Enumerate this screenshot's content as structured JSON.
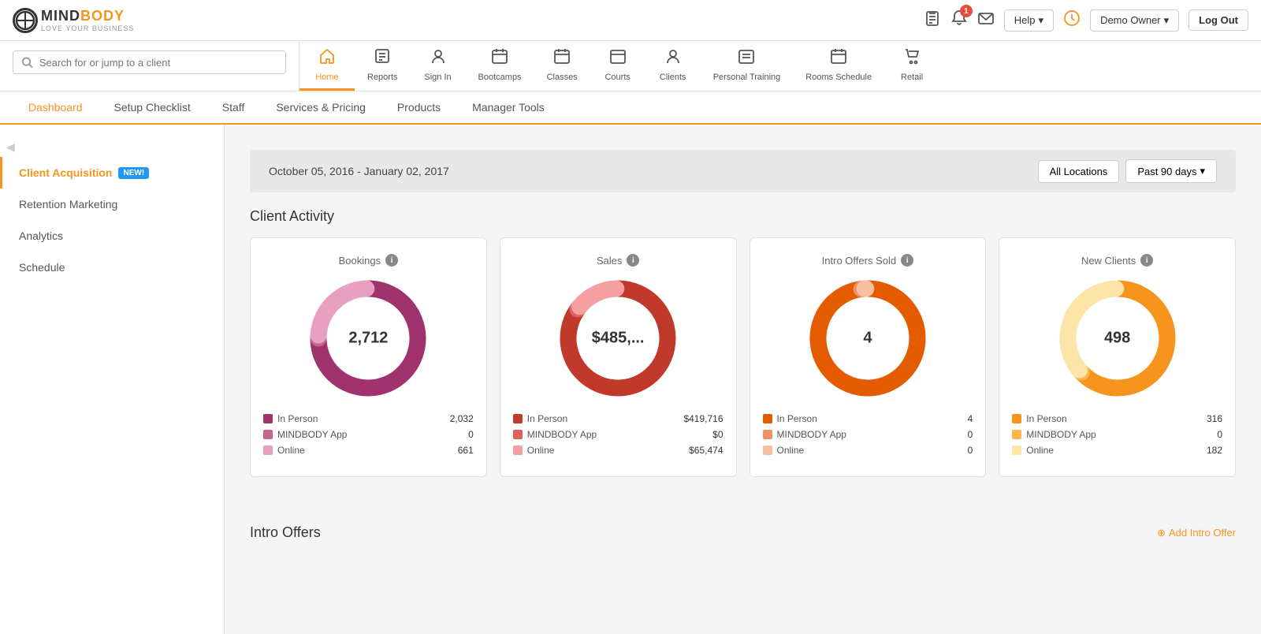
{
  "app": {
    "name": "MINDBODY",
    "tagline": "LOVE YOUR BUSINESS"
  },
  "top_bar": {
    "help_label": "Help",
    "user_label": "Demo Owner",
    "logout_label": "Log Out",
    "notification_count": "1"
  },
  "search": {
    "placeholder": "Search for or jump to a client"
  },
  "nav_tabs": [
    {
      "id": "home",
      "label": "Home",
      "icon": "🏠",
      "active": true
    },
    {
      "id": "reports",
      "label": "Reports",
      "icon": "📊",
      "active": false
    },
    {
      "id": "sign-in",
      "label": "Sign In",
      "icon": "👤",
      "active": false
    },
    {
      "id": "bootcamps",
      "label": "Bootcamps",
      "icon": "📅",
      "active": false
    },
    {
      "id": "classes",
      "label": "Classes",
      "icon": "📋",
      "active": false
    },
    {
      "id": "courts",
      "label": "Courts",
      "icon": "📅",
      "active": false
    },
    {
      "id": "clients",
      "label": "Clients",
      "icon": "👤",
      "active": false
    },
    {
      "id": "personal-training",
      "label": "Personal Training",
      "icon": "📋",
      "active": false
    },
    {
      "id": "rooms-schedule",
      "label": "Rooms Schedule",
      "icon": "📅",
      "active": false
    },
    {
      "id": "retail",
      "label": "Retail",
      "icon": "🛍",
      "active": false
    }
  ],
  "sub_nav": [
    {
      "label": "Dashboard",
      "active": true
    },
    {
      "label": "Setup Checklist",
      "active": false
    },
    {
      "label": "Staff",
      "active": false
    },
    {
      "label": "Services & Pricing",
      "active": false
    },
    {
      "label": "Products",
      "active": false
    },
    {
      "label": "Manager Tools",
      "active": false
    }
  ],
  "sidebar": {
    "items": [
      {
        "id": "client-acquisition",
        "label": "Client Acquisition",
        "active": true,
        "badge": "NEW!"
      },
      {
        "id": "retention-marketing",
        "label": "Retention Marketing",
        "active": false
      },
      {
        "id": "analytics",
        "label": "Analytics",
        "active": false
      },
      {
        "id": "schedule",
        "label": "Schedule",
        "active": false
      }
    ]
  },
  "dashboard": {
    "date_range": "October 05, 2016 - January 02, 2017",
    "location_filter": "All Locations",
    "time_filter": "Past 90 days",
    "section_title": "Client Activity",
    "cards": [
      {
        "id": "bookings",
        "title": "Bookings",
        "center_value": "2,712",
        "segments": [
          {
            "label": "In Person",
            "value": "2,032",
            "color": "#a0336e",
            "pct": 75
          },
          {
            "label": "MINDBODY App",
            "value": "0",
            "color": "#c7668a",
            "pct": 1
          },
          {
            "label": "Online",
            "value": "661",
            "color": "#e8a0c0",
            "pct": 24
          }
        ],
        "donut_colors": [
          "#a0336e",
          "#c7668a",
          "#e8a0c0"
        ]
      },
      {
        "id": "sales",
        "title": "Sales",
        "center_value": "$485,...",
        "segments": [
          {
            "label": "In Person",
            "value": "$419,716",
            "color": "#c0392b",
            "pct": 85
          },
          {
            "label": "MINDBODY App",
            "value": "$0",
            "color": "#e06060",
            "pct": 1
          },
          {
            "label": "Online",
            "value": "$65,474",
            "color": "#f5a0a0",
            "pct": 14
          }
        ],
        "donut_colors": [
          "#c0392b",
          "#e06060",
          "#f5a0a0"
        ]
      },
      {
        "id": "intro-offers-sold",
        "title": "Intro Offers Sold",
        "center_value": "4",
        "segments": [
          {
            "label": "In Person",
            "value": "4",
            "color": "#e55c00",
            "pct": 98
          },
          {
            "label": "MINDBODY App",
            "value": "0",
            "color": "#f0906b",
            "pct": 1
          },
          {
            "label": "Online",
            "value": "0",
            "color": "#f7c0a0",
            "pct": 1
          }
        ],
        "donut_colors": [
          "#e55c00",
          "#f0906b",
          "#f7c0a0"
        ]
      },
      {
        "id": "new-clients",
        "title": "New Clients",
        "center_value": "498",
        "segments": [
          {
            "label": "In Person",
            "value": "316",
            "color": "#f7941d",
            "pct": 63
          },
          {
            "label": "MINDBODY App",
            "value": "0",
            "color": "#fbb84a",
            "pct": 1
          },
          {
            "label": "Online",
            "value": "182",
            "color": "#fde4a8",
            "pct": 36
          }
        ],
        "donut_colors": [
          "#f7941d",
          "#fbb84a",
          "#fde4a8"
        ]
      }
    ],
    "intro_offers_title": "Intro Offers",
    "add_intro_offer_label": "Add Intro Offer"
  }
}
